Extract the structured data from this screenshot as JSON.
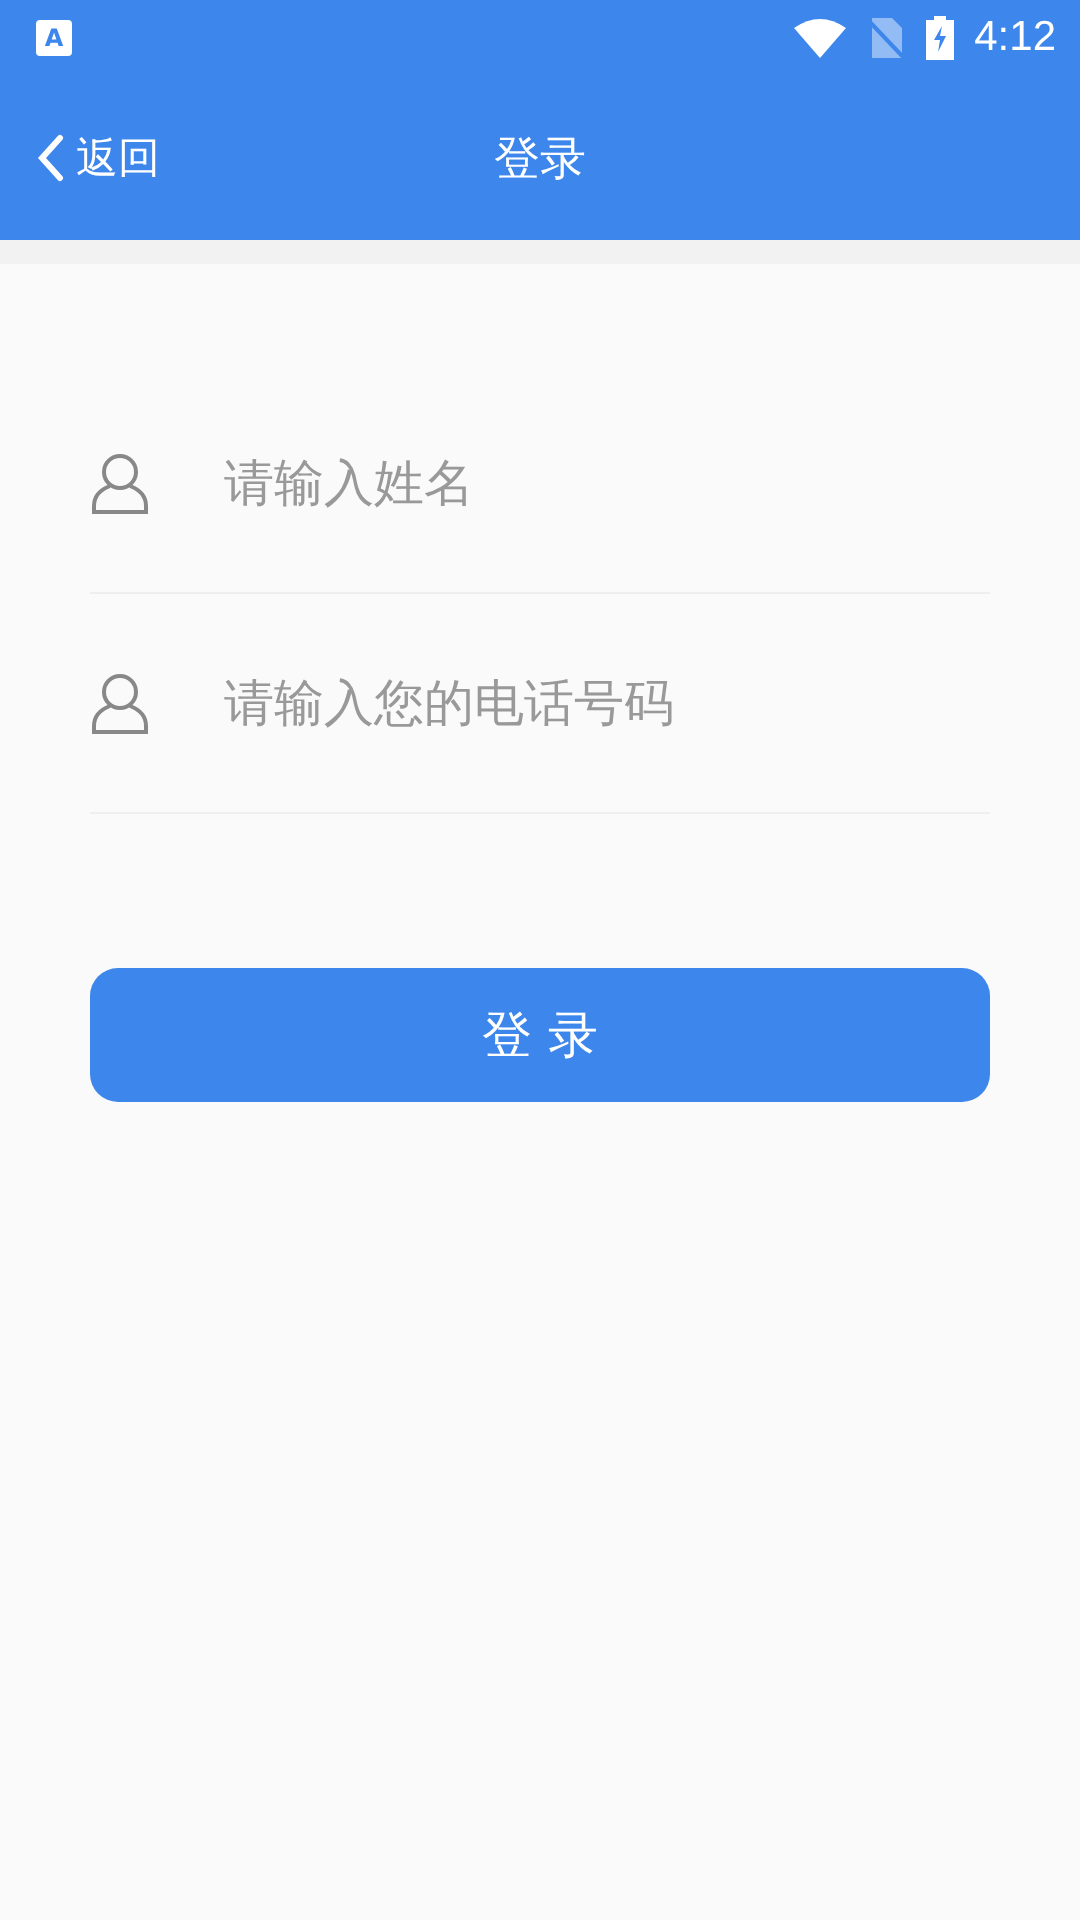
{
  "status_bar": {
    "notification_icon": "A",
    "time": "4:12"
  },
  "app_bar": {
    "back": "返回",
    "title": "登录"
  },
  "fields": [
    {
      "placeholder": "请输入姓名"
    },
    {
      "placeholder": "请输入您的电话号码"
    }
  ],
  "submit": "登 录"
}
